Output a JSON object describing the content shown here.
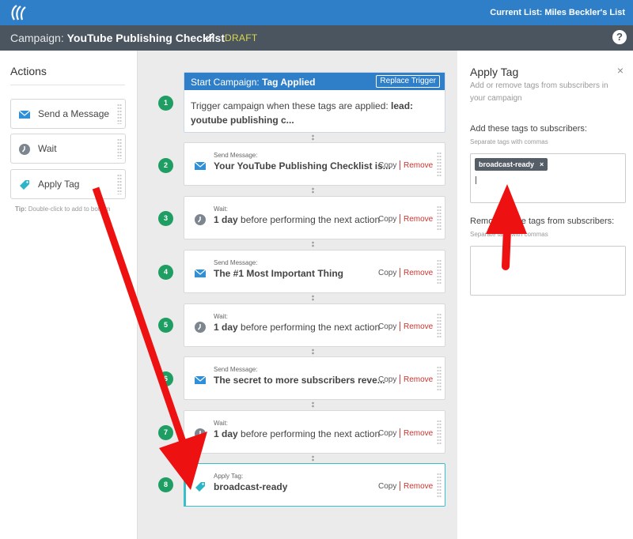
{
  "header": {
    "current_list": "Current List: Miles Beckler's List"
  },
  "subbar": {
    "campaign_prefix": "Campaign:",
    "campaign_name": "YouTube Publishing Checklist",
    "status": "DRAFT",
    "help_label": "?"
  },
  "actions": {
    "title": "Actions",
    "items": [
      {
        "label": "Send a Message",
        "icon": "envelope-icon"
      },
      {
        "label": "Wait",
        "icon": "clock-icon"
      },
      {
        "label": "Apply Tag",
        "icon": "tag-icon"
      }
    ],
    "tip_bold": "Tip:",
    "tip_text": "Double-click to add to bottom"
  },
  "trigger": {
    "head_prefix": "Start Campaign:",
    "head_bold": "Tag Applied",
    "replace_label": "Replace Trigger",
    "body_text": "Trigger campaign when these tags are applied:",
    "body_bold": "lead: youtube publishing c..."
  },
  "steps": [
    {
      "number": "1"
    },
    {
      "number": "2",
      "kind": "Send Message:",
      "bold": "Your YouTube Publishing Checklist is...",
      "rest": "",
      "icon": "envelope-icon"
    },
    {
      "number": "3",
      "kind": "Wait:",
      "bold": "1 day",
      "rest": " before performing the next action",
      "icon": "clock-icon"
    },
    {
      "number": "4",
      "kind": "Send Message:",
      "bold": "The #1 Most Important Thing",
      "rest": "",
      "icon": "envelope-icon"
    },
    {
      "number": "5",
      "kind": "Wait:",
      "bold": "1 day",
      "rest": " before performing the next action",
      "icon": "clock-icon"
    },
    {
      "number": "6",
      "kind": "Send Message:",
      "bold": "The secret to more subscribers reve...",
      "rest": "",
      "icon": "envelope-icon"
    },
    {
      "number": "7",
      "kind": "Wait:",
      "bold": "1 day",
      "rest": " before performing the next action",
      "icon": "clock-icon"
    },
    {
      "number": "8",
      "kind": "Apply Tag:",
      "bold": "broadcast-ready",
      "rest": "",
      "icon": "tag-icon"
    }
  ],
  "step_controls": {
    "copy": "Copy",
    "remove": "Remove"
  },
  "apply_tag_panel": {
    "title": "Apply Tag",
    "close": "×",
    "description": "Add or remove tags from subscribers in your campaign",
    "add_label": "Add these tags to subscribers:",
    "add_hint": "Separate tags with commas",
    "tag": "broadcast-ready",
    "tag_remove": "×",
    "remove_label": "Remove these tags from subscribers:",
    "remove_hint": "Separate tags with commas"
  },
  "colors": {
    "primary_blue": "#2f7fc8",
    "subbar": "#4a5560",
    "step_green": "#1e9e62",
    "remove_red": "#c8352f",
    "active_teal": "#37c0c7",
    "annotation_red": "#ee1111"
  }
}
